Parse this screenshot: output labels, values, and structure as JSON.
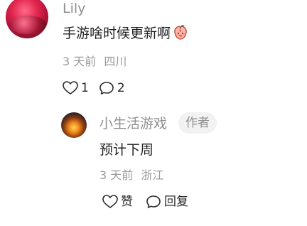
{
  "comment": {
    "user_name": "Lily",
    "text": "手游啥时候更新啊",
    "emoji": "peach-face-icon",
    "time": "3 天前",
    "location": "四川",
    "like_count": "1",
    "reply_count": "2"
  },
  "reply": {
    "user_name": "小生活游戏",
    "badge": "作者",
    "text": "预计下周",
    "time": "3 天前",
    "location": "浙江",
    "like_label": "赞",
    "reply_label": "回复"
  },
  "colors": {
    "secondary_text": "#8f8f8f",
    "primary_text": "#1f1f1f",
    "badge_bg": "#f2f2f2"
  }
}
